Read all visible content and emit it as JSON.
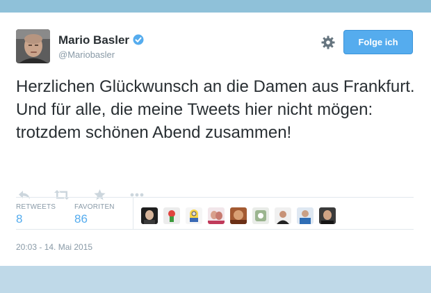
{
  "header": {
    "display_name": "Mario Basler",
    "handle": "@Mariobasler",
    "verified_icon": "verified-badge-icon",
    "settings_icon": "gear-icon",
    "follow_label": "Folge ich"
  },
  "tweet": {
    "text": "Herzlichen Glückwunsch an die Damen aus Frankfurt. Und für alle, die meine Tweets hier nicht mögen: trotzdem schönen Abend zusammen!",
    "timestamp": "20:03 - 14. Mai 2015"
  },
  "actions": [
    {
      "name": "reply",
      "icon": "reply-icon"
    },
    {
      "name": "retweet",
      "icon": "retweet-icon"
    },
    {
      "name": "favorite",
      "icon": "star-icon"
    },
    {
      "name": "more",
      "icon": "more-dots-icon"
    }
  ],
  "stats": {
    "retweets_label": "RETWEETS",
    "retweets_count": "8",
    "favorites_label": "FAVORITEN",
    "favorites_count": "86"
  },
  "favoriters_icons": [
    "avatar-1",
    "avatar-2",
    "avatar-3",
    "avatar-4",
    "avatar-5",
    "avatar-6",
    "avatar-7",
    "avatar-8",
    "avatar-9"
  ],
  "colors": {
    "accent": "#55acee",
    "text": "#292f33",
    "muted": "#8899a6",
    "band_top": "#8fc1d9",
    "band_bottom": "#bfd9e8"
  }
}
